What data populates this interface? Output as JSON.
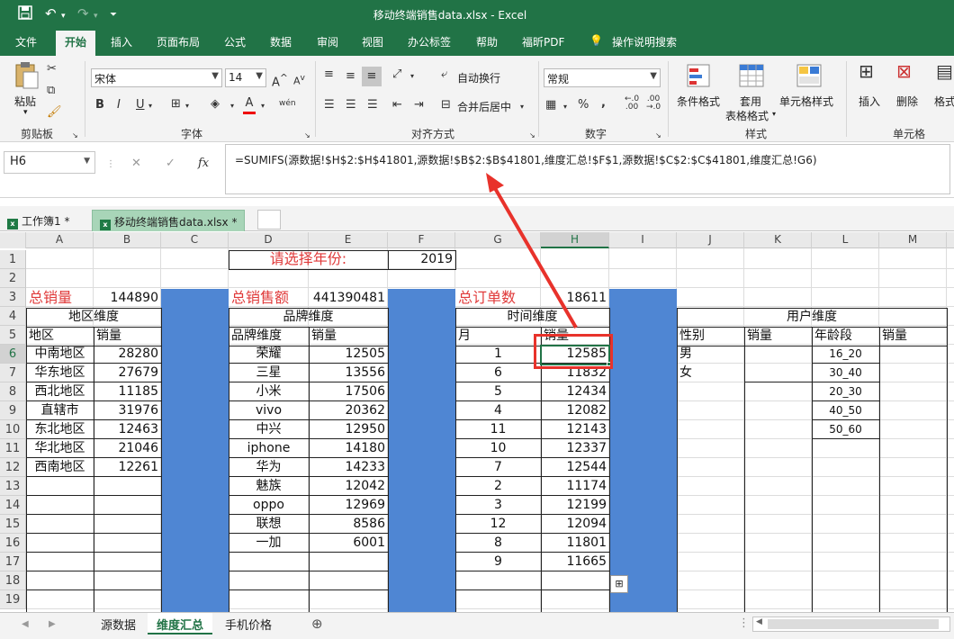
{
  "title_bar": {
    "title": "移动终端销售data.xlsx  -  Excel",
    "save_icon": "save-icon",
    "undo_icon": "undo-icon",
    "redo_icon": "redo-icon",
    "customize_icon": "customize-quick-access-icon"
  },
  "ribbon_tabs": [
    "文件",
    "开始",
    "插入",
    "页面布局",
    "公式",
    "数据",
    "审阅",
    "视图",
    "办公标签",
    "帮助",
    "福昕PDF",
    "操作说明搜索"
  ],
  "ribbon": {
    "clipboard": {
      "paste": "粘贴",
      "label": "剪贴板"
    },
    "font": {
      "font_name": "宋体",
      "font_size": "14",
      "bold": "B",
      "italic": "I",
      "underline": "U",
      "font_color": "A",
      "phonetic": "wén",
      "label": "字体"
    },
    "alignment": {
      "wrap": "自动换行",
      "merge": "合并后居中",
      "label": "对齐方式"
    },
    "number": {
      "format": "常规",
      "percent": "%",
      "comma": ",",
      "label": "数字"
    },
    "styles": {
      "conditional": "条件格式",
      "table_line1": "套用",
      "table_line2": "表格格式",
      "cell_styles": "单元格样式",
      "label": "样式"
    },
    "cells": {
      "insert": "插入",
      "delete": "删除",
      "format": "格式",
      "label": "单元格"
    }
  },
  "formula_bar": {
    "name_box": "H6",
    "cancel": "✕",
    "enter": "✓",
    "fx": "fx",
    "formula": "=SUMIFS(源数据!$H$2:$H$41801,源数据!$B$2:$B$41801,维度汇总!$F$1,源数据!$C$2:$C$41801,维度汇总!G6)"
  },
  "workbook_tabs": [
    {
      "label": "工作簿1 *",
      "active": false
    },
    {
      "label": "移动终端销售data.xlsx *",
      "active": true
    }
  ],
  "columns": [
    "A",
    "B",
    "C",
    "D",
    "E",
    "F",
    "G",
    "H",
    "I",
    "J",
    "K",
    "L",
    "M"
  ],
  "rows": [
    "1",
    "2",
    "3",
    "4",
    "5",
    "6",
    "7",
    "8",
    "9",
    "10",
    "11",
    "12",
    "13",
    "14",
    "15",
    "16",
    "17",
    "18",
    "19"
  ],
  "selected_cell": {
    "col": "H",
    "row": "6"
  },
  "sheet": {
    "year_prompt": "请选择年份:",
    "year": "2019",
    "total_sales_label": "总销量",
    "total_sales": "144890",
    "total_amount_label": "总销售额",
    "total_amount": "441390481",
    "total_orders_label": "总订单数",
    "total_orders": "18611",
    "region": {
      "header": "地区维度",
      "col1": "地区",
      "col2": "销量",
      "rows": [
        [
          "中南地区",
          "28280"
        ],
        [
          "华东地区",
          "27679"
        ],
        [
          "西北地区",
          "11185"
        ],
        [
          "直辖市",
          "31976"
        ],
        [
          "东北地区",
          "12463"
        ],
        [
          "华北地区",
          "21046"
        ],
        [
          "西南地区",
          "12261"
        ]
      ]
    },
    "brand": {
      "header": "品牌维度",
      "col1": "品牌维度",
      "col2": "销量",
      "rows": [
        [
          "荣耀",
          "12505"
        ],
        [
          "三星",
          "13556"
        ],
        [
          "小米",
          "17506"
        ],
        [
          "vivo",
          "20362"
        ],
        [
          "中兴",
          "12950"
        ],
        [
          "iphone",
          "14180"
        ],
        [
          "华为",
          "14233"
        ],
        [
          "魅族",
          "12042"
        ],
        [
          "oppo",
          "12969"
        ],
        [
          "联想",
          "8586"
        ],
        [
          "一加",
          "6001"
        ]
      ]
    },
    "time": {
      "header": "时间维度",
      "col1": "月",
      "col2": "销量",
      "rows": [
        [
          "1",
          "12585"
        ],
        [
          "6",
          "11832"
        ],
        [
          "5",
          "12434"
        ],
        [
          "4",
          "12082"
        ],
        [
          "11",
          "12143"
        ],
        [
          "10",
          "12337"
        ],
        [
          "7",
          "12544"
        ],
        [
          "2",
          "11174"
        ],
        [
          "3",
          "12199"
        ],
        [
          "12",
          "12094"
        ],
        [
          "8",
          "11801"
        ],
        [
          "9",
          "11665"
        ]
      ]
    },
    "user": {
      "header": "用户维度",
      "gender_col": "性别",
      "sales_col": "销量",
      "age_col": "年龄段",
      "sales_col2": "销量",
      "genders": [
        "男",
        "女"
      ],
      "ages": [
        "16_20",
        "30_40",
        "20_30",
        "40_50",
        "50_60"
      ]
    }
  },
  "sheet_tabs": [
    {
      "label": "源数据",
      "active": false
    },
    {
      "label": "维度汇总",
      "active": true
    },
    {
      "label": "手机价格",
      "active": false
    }
  ],
  "annotation": {
    "color": "#e8322b"
  },
  "colors": {
    "excel_green": "#217346",
    "column_fill": "#4f86d3",
    "accent_red": "#e03a3a"
  }
}
